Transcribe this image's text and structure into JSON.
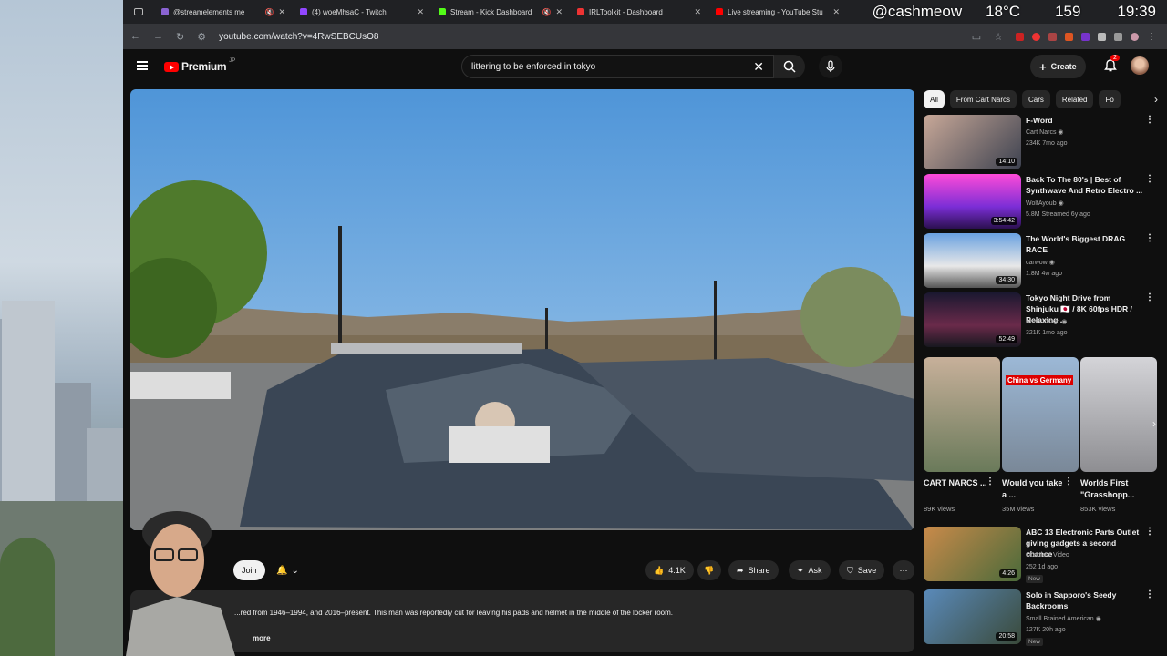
{
  "browser": {
    "tabs": [
      {
        "title": "@streamelements me",
        "color": "#8a63d2"
      },
      {
        "title": "(4) woeMhsaC - Twitch",
        "color": "#9146ff"
      },
      {
        "title": "Stream - Kick Dashboard",
        "color": "#53fc18"
      },
      {
        "title": "IRLToolkit - Dashboard",
        "color": "#e33"
      },
      {
        "title": "Live streaming - YouTube Stu",
        "color": "#f00"
      }
    ],
    "url": "youtube.com/watch?v=4RwSEBCUsO8"
  },
  "stream_overlay": {
    "handle": "@cashmeow",
    "temperature": "18°C",
    "viewers": "159",
    "time": "19:39"
  },
  "youtube": {
    "logo_text": "Premium",
    "region": "JP",
    "search_query": "littering to be enforced in tokyo",
    "create_label": "Create",
    "notif_count": "2",
    "join_label": "Join",
    "likes": "4.1K",
    "share_label": "Share",
    "ask_label": "Ask",
    "save_label": "Save",
    "description": "...red from 1946–1994, and 2016–present.  This man was reportedly cut for leaving his pads and helmet in the middle of the locker room.",
    "more_label": "more"
  },
  "chips": [
    "All",
    "From Cart Narcs",
    "Cars",
    "Related",
    "Fo"
  ],
  "recommendations": [
    {
      "title": "F-Word",
      "channel": "Cart Narcs",
      "verified": true,
      "meta": "234K  7mo ago",
      "duration": "14:10",
      "thumb": "#4a4a55"
    },
    {
      "title": "Back To The 80's | Best of Synthwave And Retro Electro ...",
      "channel": "WolfAyoub",
      "verified": true,
      "meta": "5.8M  Streamed 6y ago",
      "duration": "3:54:42",
      "thumb": "#c23cc8"
    },
    {
      "title": "The World's Biggest DRAG RACE",
      "channel": "carwow",
      "verified": true,
      "meta": "1.8M  4w ago",
      "duration": "34:30",
      "thumb": "#5a8acb"
    },
    {
      "title": "Tokyo Night Drive from Shinjuku 🇯🇵 / 8K 60fps HDR / Relaxing ...",
      "channel": "Abao Vision",
      "verified": true,
      "meta": "321K  1mo ago",
      "duration": "52:49",
      "thumb": "#2a2640"
    }
  ],
  "shorts": [
    {
      "title": "CART NARCS ...",
      "views": "89K views",
      "thumb": "#6a7a5a",
      "overlay": ""
    },
    {
      "title": "Would you take a ...",
      "views": "35M views",
      "thumb": "#7a98b8",
      "overlay": "China vs Germany"
    },
    {
      "title": "Worlds First \"Grasshopp...",
      "views": "853K views",
      "thumb": "#b4b4b8",
      "overlay": ""
    }
  ],
  "more_recs": [
    {
      "title": "ABC 13 Electronic Parts Outlet giving gadgets a second chance",
      "channel": "Obsolete Video",
      "meta": "252  1d ago",
      "badge": "New",
      "duration": "4:26",
      "thumb": "#a86a3a"
    },
    {
      "title": "Solo in Sapporo's Seedy Backrooms",
      "channel": "Small Brained American",
      "verified": true,
      "meta": "127K  20h ago",
      "badge": "New",
      "duration": "20:58",
      "thumb": "#5a7090"
    }
  ]
}
